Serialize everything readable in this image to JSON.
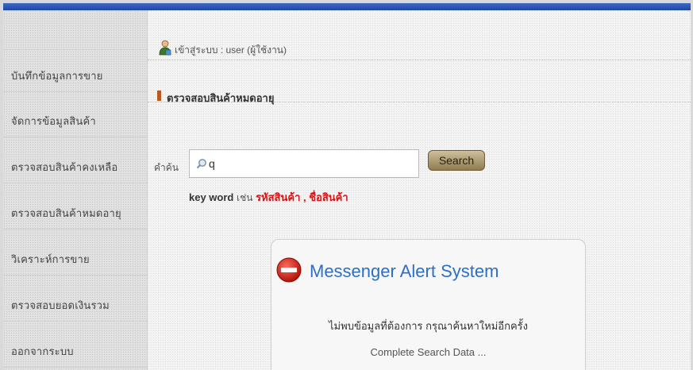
{
  "sidebar": {
    "items": [
      {
        "label": "บันทึกข้อมูลการขาย"
      },
      {
        "label": "จัดการข้อมูลสินค้า"
      },
      {
        "label": "ตรวจสอบสินค้าคงเหลือ"
      },
      {
        "label": "ตรวจสอบสินค้าหมดอายุ"
      },
      {
        "label": "วิเคราะห์การขาย"
      },
      {
        "label": "ตรวจสอบยอดเงินรวม"
      },
      {
        "label": "ออกจากระบบ"
      }
    ]
  },
  "header": {
    "user_text": "เข้าสู่ระบบ : user (ผู้ใช้งาน)",
    "user_icon": "user-icon"
  },
  "section": {
    "title": "ตรวจสอบสินค้าหมดอายุ"
  },
  "search": {
    "label": "คำค้น",
    "value": "q",
    "button_label": "Search",
    "hint_keyword": "key word",
    "hint_such_as": "เช่น",
    "hint_examples": "รหัสสินค้า , ชื่อสินค้า"
  },
  "alert": {
    "title": "Messenger Alert System",
    "message": "ไม่พบข้อมูลที่ต้องการ กรุณาค้นหาใหม่อีกครั้ง",
    "sub_message": "Complete Search Data ...",
    "icon": "stop-icon"
  },
  "colors": {
    "topbar": "#2a52b4",
    "accent_red": "#d41515",
    "alert_title": "#2d6fc2",
    "button": "#a8956a"
  }
}
